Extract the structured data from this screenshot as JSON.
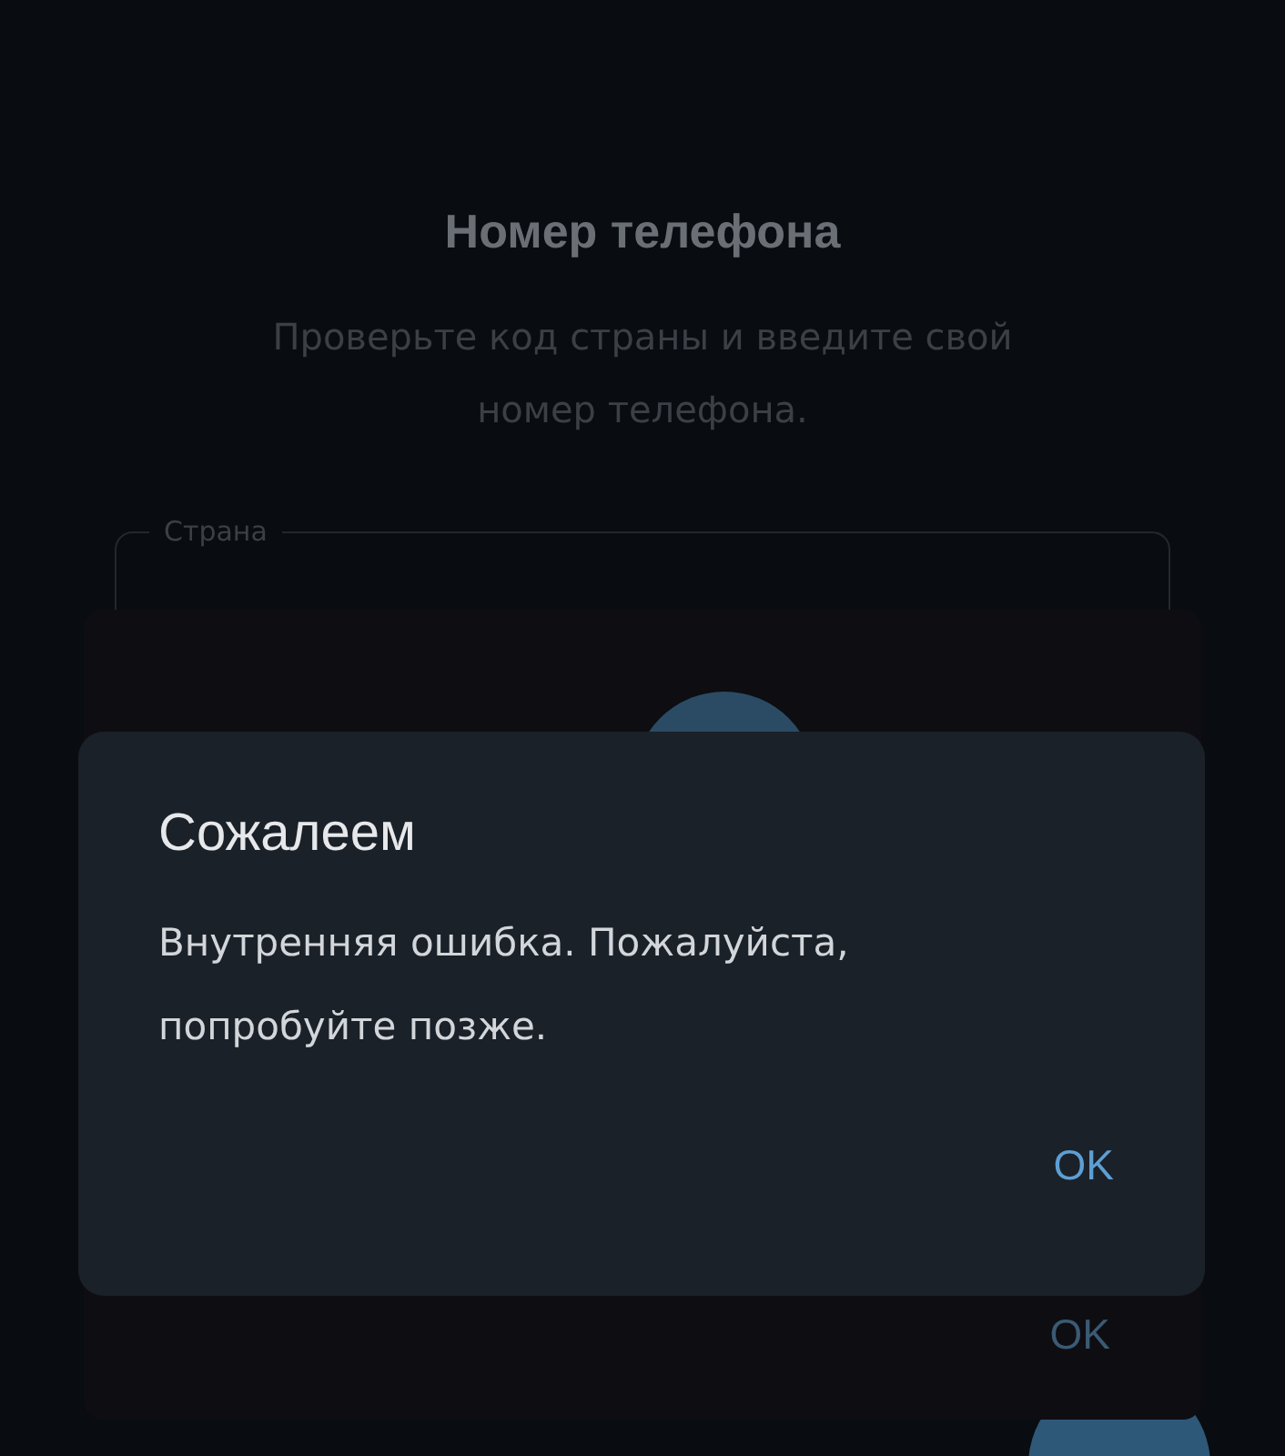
{
  "screen": {
    "title": "Номер телефона",
    "subtitle": "Проверьте код страны и введите свой номер телефона.",
    "country_field": {
      "label": "Страна"
    }
  },
  "back_dialog": {
    "button": "OK"
  },
  "dialog": {
    "title": "Сожалеем",
    "message": "Внутренняя ошибка. Пожалуйста, попробуйте позже.",
    "button": "OK"
  }
}
